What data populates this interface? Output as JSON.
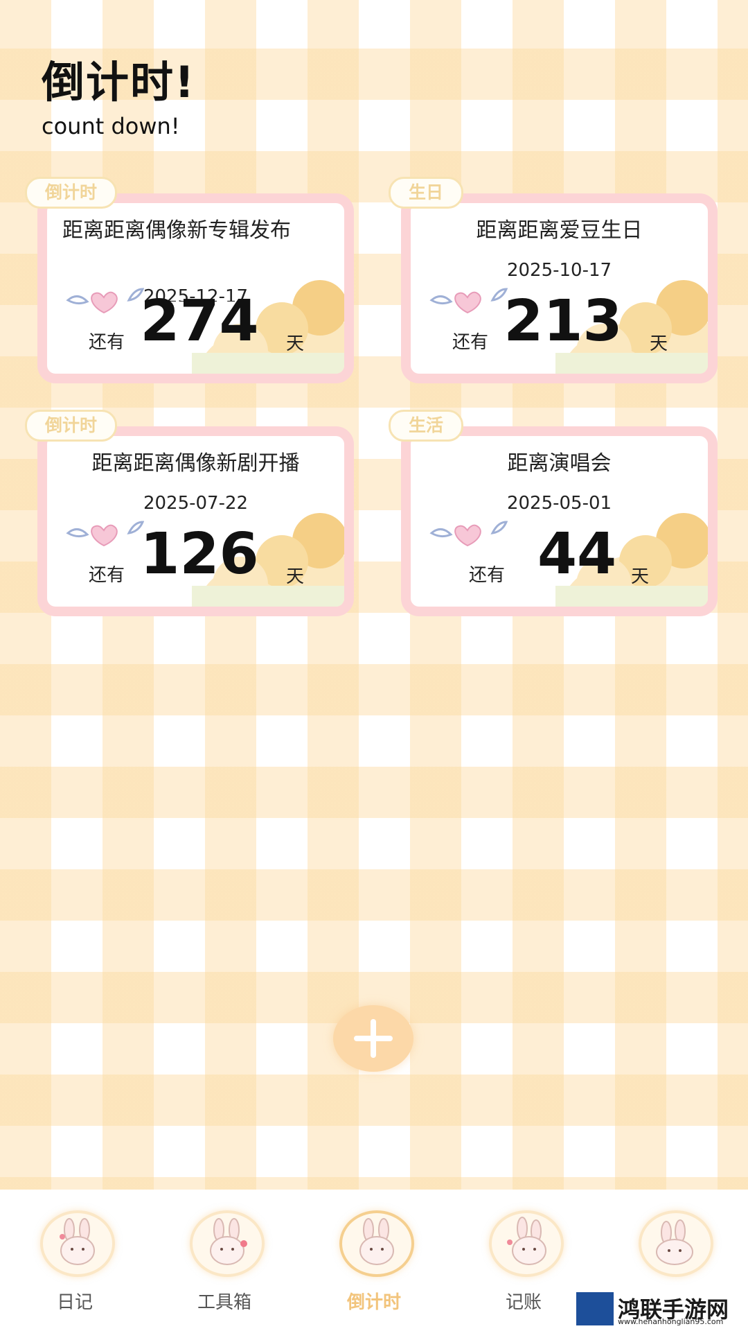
{
  "header": {
    "title": "倒计时!",
    "subtitle": "count down!"
  },
  "cards": [
    {
      "tag": "倒计时",
      "title": "距离距离偶像新专辑发布",
      "date": "2025-12-17",
      "remain_label": "还有",
      "days": "274",
      "unit": "天"
    },
    {
      "tag": "生日",
      "title": "距离距离爱豆生日",
      "date": "2025-10-17",
      "remain_label": "还有",
      "days": "213",
      "unit": "天"
    },
    {
      "tag": "倒计时",
      "title": "距离距离偶像新剧开播",
      "date": "2025-07-22",
      "remain_label": "还有",
      "days": "126",
      "unit": "天"
    },
    {
      "tag": "生活",
      "title": "距离演唱会",
      "date": "2025-05-01",
      "remain_label": "还有",
      "days": "44",
      "unit": "天"
    }
  ],
  "fab": {
    "icon": "plus-icon"
  },
  "tabbar": {
    "items": [
      {
        "label": "日记",
        "icon": "bunny-avatar-icon",
        "active": false
      },
      {
        "label": "工具箱",
        "icon": "bunny-avatar-icon",
        "active": false
      },
      {
        "label": "倒计时",
        "icon": "bunny-avatar-icon",
        "active": true
      },
      {
        "label": "记账",
        "icon": "bunny-avatar-icon",
        "active": false
      },
      {
        "label": "",
        "icon": "bunny-avatar-icon",
        "active": false
      }
    ]
  },
  "watermark": {
    "text": "鸿联手游网",
    "url": "www.henanhonglian95.com"
  },
  "colors": {
    "card_border": "#fcd4d6",
    "tag_text": "#f1d599",
    "fab": "#fcd8a8",
    "active_tab": "#f2c47c"
  }
}
